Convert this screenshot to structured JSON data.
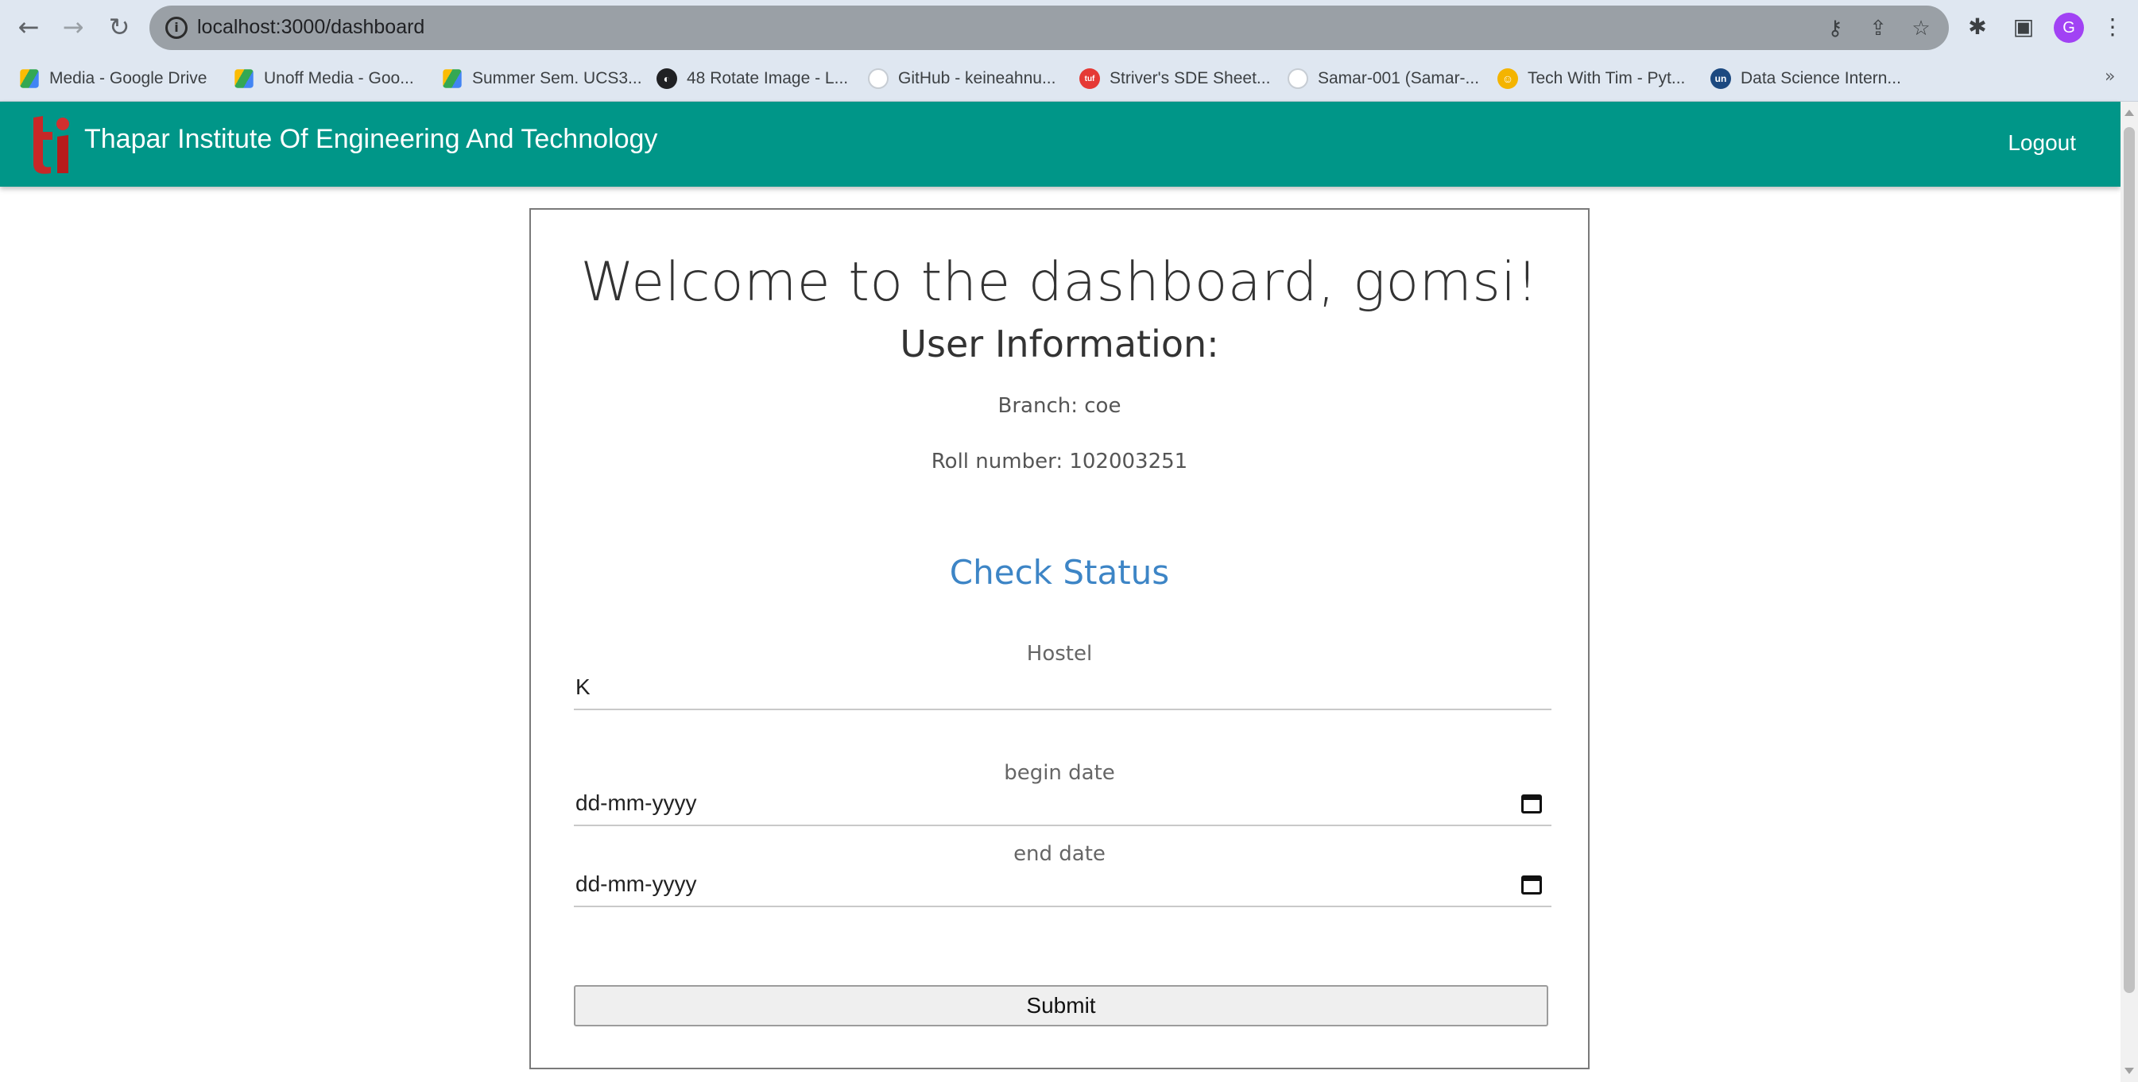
{
  "browser": {
    "url": "localhost:3000/dashboard",
    "avatar_letter": "G",
    "bookmarks": [
      {
        "label": "Media - Google Drive",
        "icon": "google-drive-icon"
      },
      {
        "label": "Unoff Media - Goo...",
        "icon": "google-drive-icon"
      },
      {
        "label": "Summer Sem. UCS3...",
        "icon": "google-drive-icon"
      },
      {
        "label": "48 Rotate Image - L...",
        "icon": "globe-icon"
      },
      {
        "label": "GitHub - keineahnu...",
        "icon": "github-icon"
      },
      {
        "label": "Striver's SDE Sheet...",
        "icon": "tuf-icon"
      },
      {
        "label": "Samar-001 (Samar-...",
        "icon": "github-icon"
      },
      {
        "label": "Tech With Tim - Pyt...",
        "icon": "tech-with-tim-icon"
      },
      {
        "label": "Data Science Intern...",
        "icon": "unstop-icon"
      }
    ],
    "more_bookmarks": "»"
  },
  "app": {
    "brand": "Thapar Institute Of Engineering And Technology",
    "logout": "Logout",
    "theme_color": "#009688"
  },
  "dashboard": {
    "welcome": "Welcome to the dashboard, gomsi!",
    "user_info_heading": "User Information:",
    "branch": "Branch: coe",
    "roll_number": "Roll number: 102003251",
    "check_status": "Check Status",
    "hostel_label": "Hostel",
    "hostel_value": "K",
    "begin_date_label": "begin date",
    "begin_date_placeholder": "dd-mm-yyyy",
    "end_date_label": "end date",
    "end_date_placeholder": "dd-mm-yyyy",
    "submit": "Submit"
  }
}
